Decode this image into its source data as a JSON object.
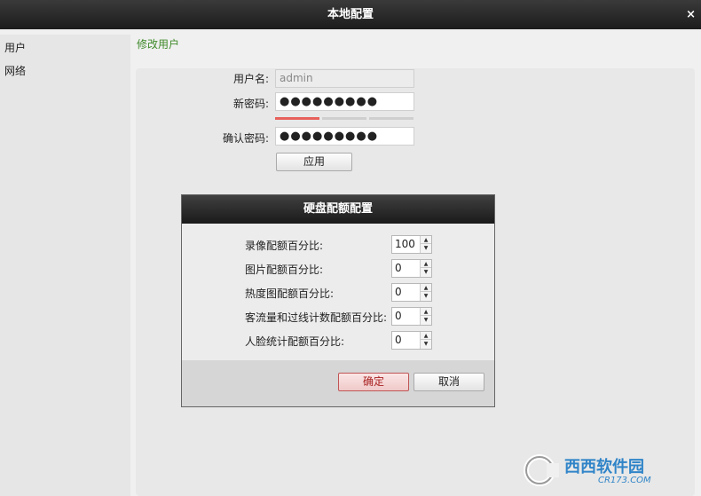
{
  "window": {
    "title": "本地配置",
    "close_glyph": "×"
  },
  "sidebar": {
    "items": [
      {
        "label": "用户"
      },
      {
        "label": "网络"
      }
    ]
  },
  "main": {
    "title": "修改用户",
    "form": {
      "username_label": "用户名:",
      "username_value": "admin",
      "new_password_label": "新密码:",
      "new_password_value": "●●●●●●●●●",
      "confirm_password_label": "确认密码:",
      "confirm_password_value": "●●●●●●●●●",
      "apply_label": "应用",
      "strength_level_fraction": 0.33,
      "strength_color": "#e8605a"
    }
  },
  "dialog": {
    "title": "硬盘配额配置",
    "rows": [
      {
        "label": "录像配额百分比:",
        "value": "100"
      },
      {
        "label": "图片配额百分比:",
        "value": "0"
      },
      {
        "label": "热度图配额百分比:",
        "value": "0"
      },
      {
        "label": "客流量和过线计数配额百分比:",
        "value": "0"
      },
      {
        "label": "人脸统计配额百分比:",
        "value": "0"
      }
    ],
    "ok_label": "确定",
    "cancel_label": "取消"
  },
  "watermark": {
    "text": "西西软件园",
    "sub": "CR173.COM"
  }
}
